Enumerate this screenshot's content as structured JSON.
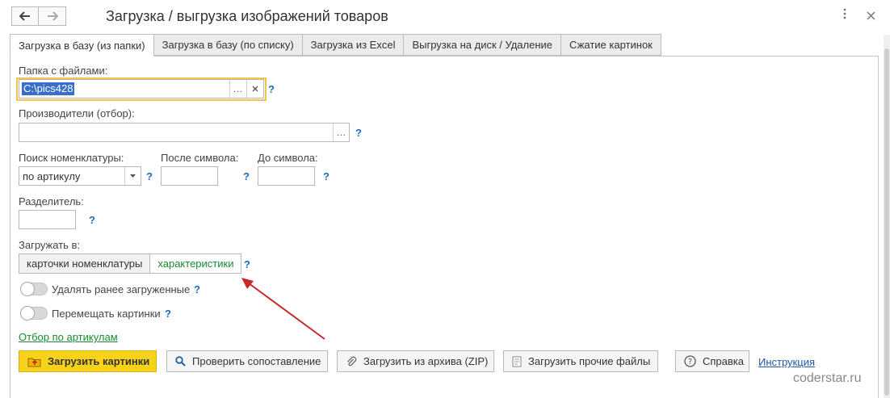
{
  "window": {
    "title": "Загрузка / выгрузка изображений товаров",
    "more_icon": "more-vertical-icon",
    "close_icon": "close-icon"
  },
  "tabs": [
    {
      "label": "Загрузка в базу (из папки)",
      "active": true
    },
    {
      "label": "Загрузка в базу (по списку)",
      "active": false
    },
    {
      "label": "Загрузка из Excel",
      "active": false
    },
    {
      "label": "Выгрузка на диск / Удаление",
      "active": false
    },
    {
      "label": "Сжатие картинок",
      "active": false
    }
  ],
  "form": {
    "folder": {
      "label": "Папка с файлами:",
      "value": "C:\\pics428",
      "help": "?"
    },
    "manufacturers": {
      "label": "Производители (отбор):",
      "value": "",
      "help": "?"
    },
    "search": {
      "label": "Поиск номенклатуры:",
      "value": "по артикулу",
      "help": "?"
    },
    "after_symbol": {
      "label": "После символа:",
      "value": "",
      "help": "?"
    },
    "to_symbol": {
      "label": "До символа:",
      "value": "",
      "help": "?"
    },
    "separator": {
      "label": "Разделитель:",
      "value": "",
      "help": "?"
    },
    "load_to": {
      "label": "Загружать в:",
      "options": [
        "карточки номенклатуры",
        "характеристики"
      ],
      "selected": "характеристики",
      "help": "?"
    },
    "delete_previous": {
      "label": "Удалять ранее загруженные",
      "on": false,
      "help": "?"
    },
    "move_pictures": {
      "label": "Перемещать картинки",
      "on": false,
      "help": "?"
    },
    "filter_link": "Отбор по артикулам"
  },
  "buttons": {
    "load_pictures": "Загрузить картинки",
    "check_mapping": "Проверить сопоставление",
    "load_zip": "Загрузить из архива (ZIP)",
    "load_other": "Загрузить прочие файлы",
    "help": "Справка",
    "instruction_link": "Инструкция"
  },
  "watermark": "coderstar.ru",
  "colors": {
    "accent": "#f7d21a",
    "focus": "#f2c54a",
    "link_green": "#1a8a2e",
    "help_blue": "#1e6bb8",
    "arrow": "#c62828"
  }
}
